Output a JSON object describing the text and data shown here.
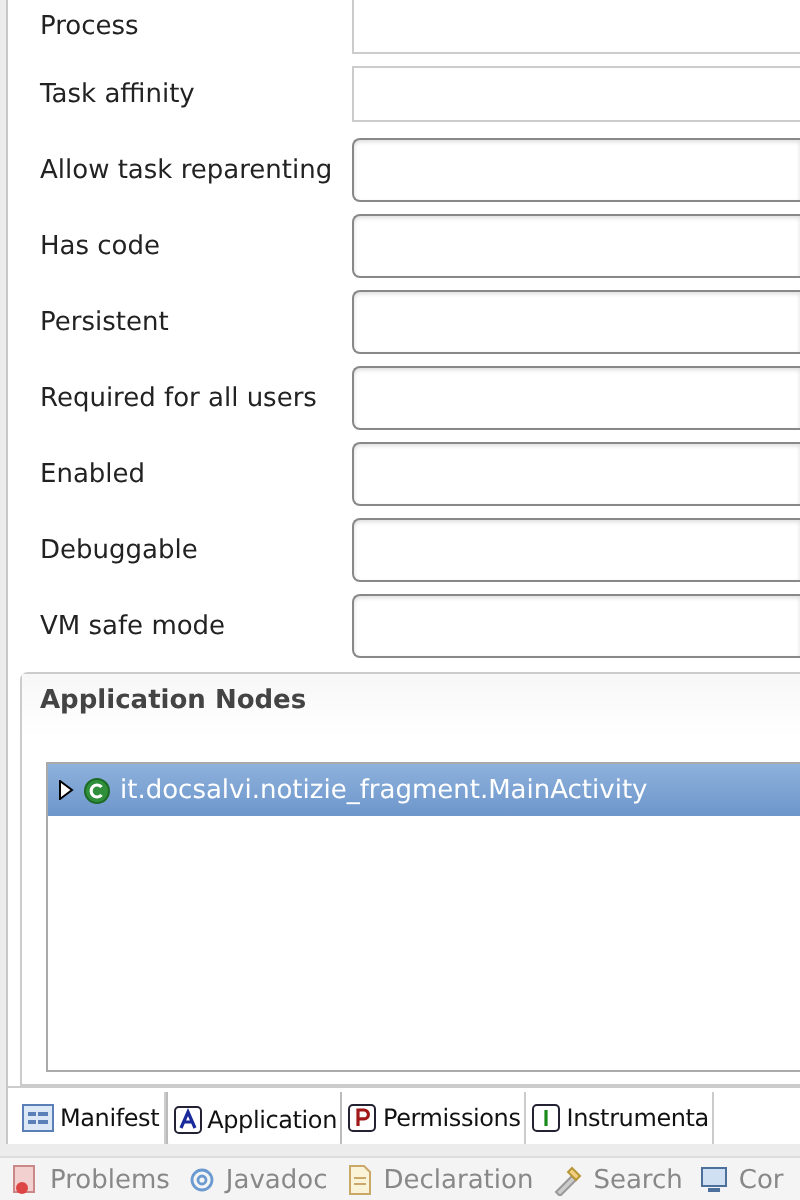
{
  "fields": [
    {
      "label": "Process",
      "kind": "text"
    },
    {
      "label": "Task affinity",
      "kind": "text"
    },
    {
      "label": "Allow task reparenting",
      "kind": "combo"
    },
    {
      "label": "Has code",
      "kind": "combo"
    },
    {
      "label": "Persistent",
      "kind": "combo"
    },
    {
      "label": "Required for all users",
      "kind": "combo"
    },
    {
      "label": "Enabled",
      "kind": "combo"
    },
    {
      "label": "Debuggable",
      "kind": "combo"
    },
    {
      "label": "VM safe mode",
      "kind": "combo"
    }
  ],
  "section": {
    "title": "Application Nodes",
    "nodes": [
      {
        "label": "it.docsalvi.notizie_fragment.MainActivity",
        "selected": true,
        "expanded": false
      }
    ]
  },
  "editor_tabs": [
    {
      "label": "Manifest",
      "selected": false,
      "kind": "manifest"
    },
    {
      "label": "Application",
      "selected": true,
      "kind": "a"
    },
    {
      "label": "Permissions",
      "selected": false,
      "kind": "p"
    },
    {
      "label": "Instrumenta",
      "selected": false,
      "kind": "i"
    }
  ],
  "views": [
    {
      "label": "Problems",
      "kind": "problems"
    },
    {
      "label": "Javadoc",
      "kind": "javadoc"
    },
    {
      "label": "Declaration",
      "kind": "declaration"
    },
    {
      "label": "Search",
      "kind": "search"
    },
    {
      "label": "Cor",
      "kind": "console"
    }
  ]
}
